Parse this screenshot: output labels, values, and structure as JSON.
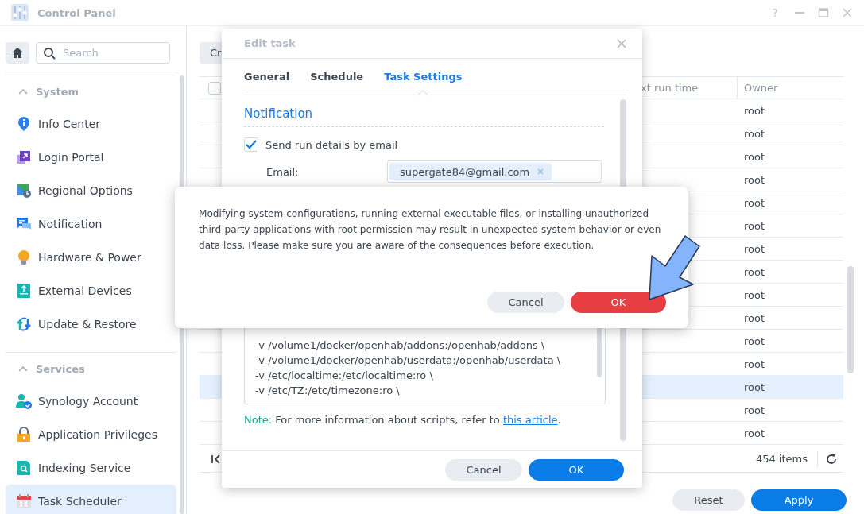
{
  "window": {
    "title": "Control Panel",
    "help": "?"
  },
  "sidebar": {
    "search_placeholder": "Search",
    "groups": [
      {
        "title": "System",
        "expanded": true,
        "items": [
          {
            "label": "Info Center",
            "selected": false
          },
          {
            "label": "Login Portal",
            "selected": false
          },
          {
            "label": "Regional Options",
            "selected": false
          },
          {
            "label": "Notification",
            "selected": false
          },
          {
            "label": "Hardware & Power",
            "selected": false
          },
          {
            "label": "External Devices",
            "selected": false
          },
          {
            "label": "Update & Restore",
            "selected": false
          }
        ]
      },
      {
        "title": "Services",
        "expanded": true,
        "items": [
          {
            "label": "Synology Account",
            "selected": false
          },
          {
            "label": "Application Privileges",
            "selected": false
          },
          {
            "label": "Indexing Service",
            "selected": false
          },
          {
            "label": "Task Scheduler",
            "selected": true
          }
        ]
      }
    ]
  },
  "toolbar": {
    "create_button": "Cr"
  },
  "table": {
    "select_all": {
      "checked": false
    },
    "columns": [
      "xt run time",
      "Owner"
    ],
    "rows": [
      {
        "owner": "root",
        "selected": false
      },
      {
        "owner": "root",
        "selected": false
      },
      {
        "owner": "root",
        "selected": false
      },
      {
        "owner": "root",
        "selected": false
      },
      {
        "owner": "root",
        "selected": false
      },
      {
        "owner": "root",
        "selected": false
      },
      {
        "owner": "root",
        "selected": false
      },
      {
        "owner": "root",
        "selected": false
      },
      {
        "owner": "root",
        "selected": false
      },
      {
        "owner": "root",
        "selected": false
      },
      {
        "owner": "root",
        "selected": false
      },
      {
        "owner": "root",
        "selected": false
      },
      {
        "owner": "root",
        "selected": true
      },
      {
        "owner": "root",
        "selected": false
      },
      {
        "owner": "root",
        "selected": false
      }
    ],
    "item_count": "454 items"
  },
  "footer_buttons": {
    "reset": "Reset",
    "apply": "Apply"
  },
  "edit_dialog": {
    "title": "Edit task",
    "tabs": [
      {
        "label": "General",
        "selected": false
      },
      {
        "label": "Schedule",
        "selected": false
      },
      {
        "label": "Task Settings",
        "selected": true
      }
    ],
    "section_title": "Notification",
    "send_email": {
      "label": "Send run details by email",
      "checked": true
    },
    "email": {
      "label": "Email:",
      "value": "supergate84@gmail.com"
    },
    "script_lines": [
      "-v /volume1/docker/openhab/addons:/openhab/addons \\",
      "-v /volume1/docker/openhab/userdata:/openhab/userdata \\",
      "-v /etc/localtime:/etc/localtime:ro \\",
      "-v /etc/TZ:/etc/timezone:ro \\"
    ],
    "note": {
      "label": "Note:",
      "text": "For more information about scripts, refer to",
      "link": "this article",
      "suffix": "."
    },
    "cancel": "Cancel",
    "ok": "OK"
  },
  "warning_dialog": {
    "message": "Modifying system configurations, running external executable files, or installing unauthorized third-party applications with root permission may result in unexpected system behavior or even data loss. Please make sure you are aware of the consequences before execution.",
    "cancel": "Cancel",
    "ok": "OK"
  }
}
